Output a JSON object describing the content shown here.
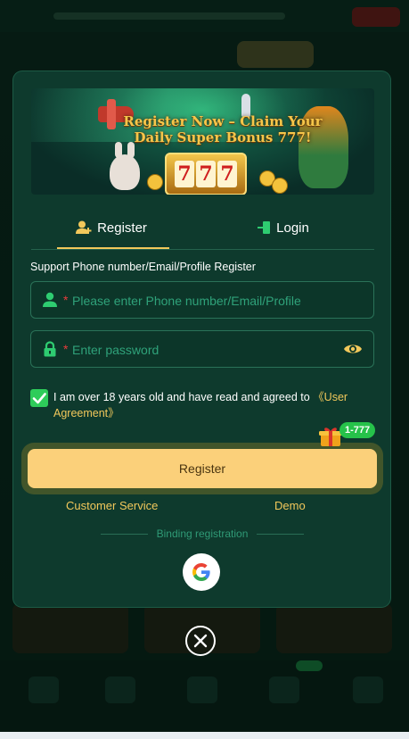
{
  "banner": {
    "headline": "Register Now – Claim Your Daily Super Bonus 777!",
    "slot_digits": [
      "7",
      "7",
      "7"
    ]
  },
  "tabs": {
    "register": "Register",
    "login": "Login",
    "active": "register"
  },
  "form": {
    "support_text": "Support Phone number/Email/Profile Register",
    "phone_placeholder": "Please enter Phone number/Email/Profile",
    "password_placeholder": "Enter password",
    "required_mark": "*",
    "agree_text": "I am over 18 years old and have read and agreed to ",
    "agree_link": "《User Agreement》",
    "agree_checked": true
  },
  "actions": {
    "register_button": "Register",
    "bonus_badge": "1-777",
    "customer_service": "Customer Service",
    "demo": "Demo",
    "binding_label": "Binding registration"
  },
  "colors": {
    "modal_bg": "#0e3a2d",
    "accent_gold": "#f2c85b",
    "button_bg": "#fbd07a",
    "input_placeholder": "#2fa27a",
    "check_green": "#2ecc5a"
  },
  "icons": {
    "register_tab": "user-plus-icon",
    "login_tab": "login-door-icon",
    "phone_field": "user-icon",
    "password_field": "lock-icon",
    "password_toggle": "eye-icon",
    "bonus": "gift-icon",
    "social": "google-icon",
    "close": "close-icon"
  }
}
